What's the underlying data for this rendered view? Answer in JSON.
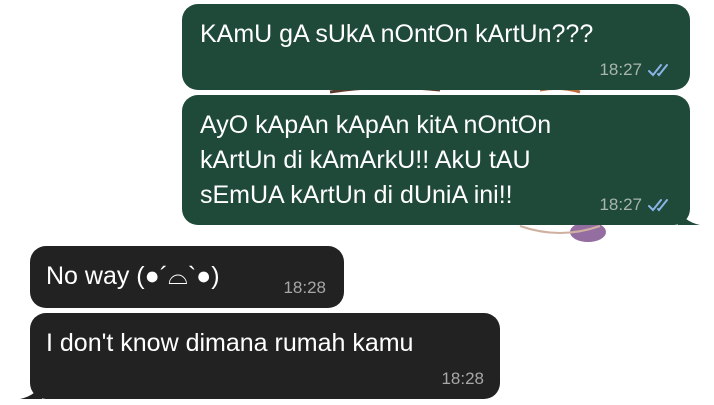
{
  "chat": {
    "messages": [
      {
        "direction": "outgoing",
        "text": "KAmU gA sUkA nOntOn kArtUn???",
        "time": "18:27",
        "status_icon": "double-check-read-icon"
      },
      {
        "direction": "outgoing",
        "text": "AyO kApAn kApAn kitA nOntOn\nkArtUn di kAmArkU!! AkU tAU\nsEmUA kArtUn di dUniA ini!!",
        "time": "18:27",
        "status_icon": "double-check-read-icon"
      },
      {
        "direction": "incoming",
        "text": "No way (●´⌓`●)",
        "time": "18:28"
      },
      {
        "direction": "incoming",
        "text": "I don't know dimana rumah kamu",
        "time": "18:28"
      }
    ]
  },
  "colors": {
    "outgoing_bubble": "#1f4a3a",
    "incoming_bubble": "#222222",
    "read_ticks": "#8ab4e8",
    "background": "#ffffff"
  }
}
